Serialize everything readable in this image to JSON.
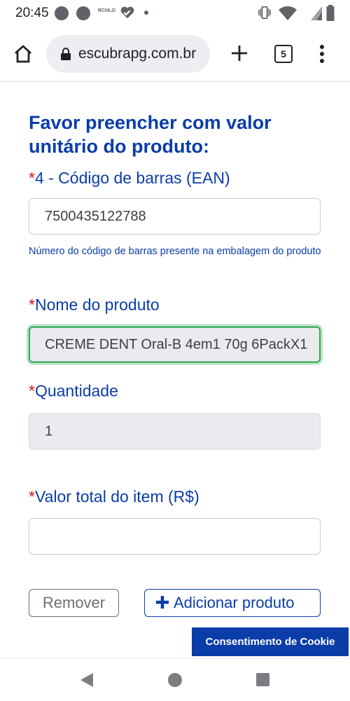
{
  "status_bar": {
    "time": "20:45",
    "notification_text": "RCHLO"
  },
  "browser": {
    "url": "escubrapg.com.br",
    "tab_count": "5",
    "icons": [
      "home-icon",
      "lock-icon",
      "new-tab-icon",
      "tab-switcher-icon",
      "more-menu-icon"
    ]
  },
  "form": {
    "title": "Favor preencher com valor unitário do produto:",
    "required_marker": "*",
    "barcode": {
      "label": "4 - Código de barras (EAN)",
      "value": "7500435122788",
      "help": "Número do código de barras presente na embalagem do produto"
    },
    "product_name": {
      "label": "Nome do produto",
      "value": "CREME DENT Oral-B 4em1 70g 6PackX1"
    },
    "quantity": {
      "label": "Quantidade",
      "value": "1"
    },
    "total_value": {
      "label": "Valor total do item (R$)",
      "value": ""
    },
    "buttons": {
      "remove": "Remover",
      "add": "Adicionar produto"
    }
  },
  "cookie": {
    "label": "Consentimento de Cookie"
  },
  "colors": {
    "brand_blue": "#0a3da8",
    "required_red": "#e3101a",
    "focus_green": "#34a853"
  }
}
